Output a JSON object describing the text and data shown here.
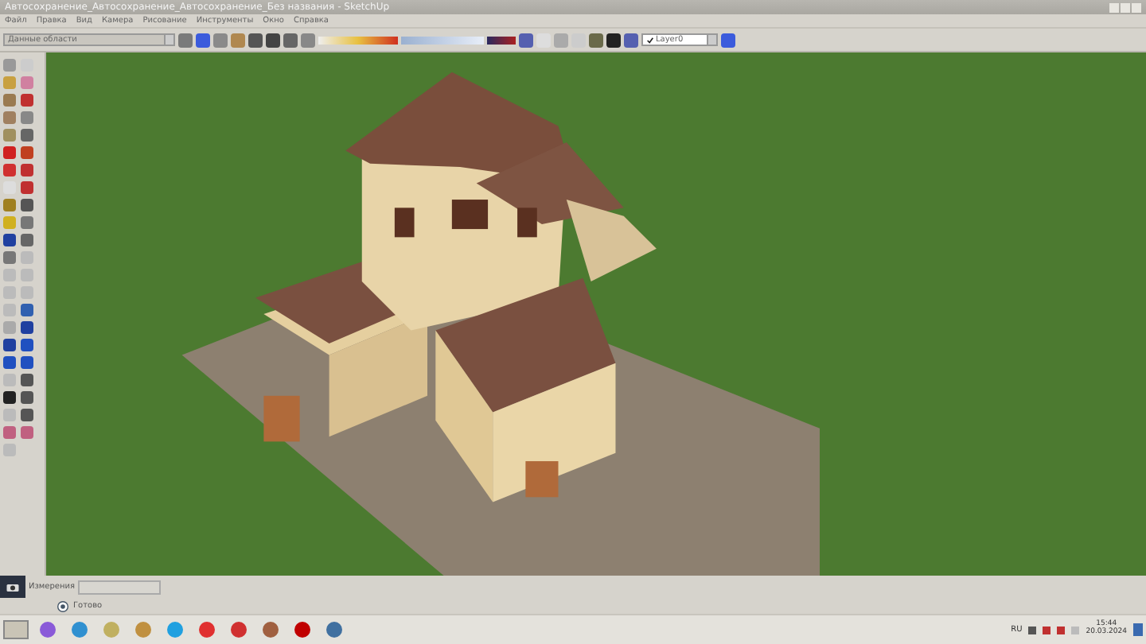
{
  "window": {
    "title": "Автосохранение_Автосохранение_Автосохранение_Без названия - SketchUp"
  },
  "menu": [
    "Файл",
    "Правка",
    "Вид",
    "Камера",
    "Рисование",
    "Инструменты",
    "Окно",
    "Справка"
  ],
  "toolbar": {
    "scene_dropdown": "Данные области",
    "layer_dropdown": "Layer0"
  },
  "status_bar": {
    "measurements_label": "Измерения",
    "status": "Готово"
  },
  "taskbar": {
    "language": "RU",
    "time": "15:44",
    "date": "20.03.2024"
  }
}
